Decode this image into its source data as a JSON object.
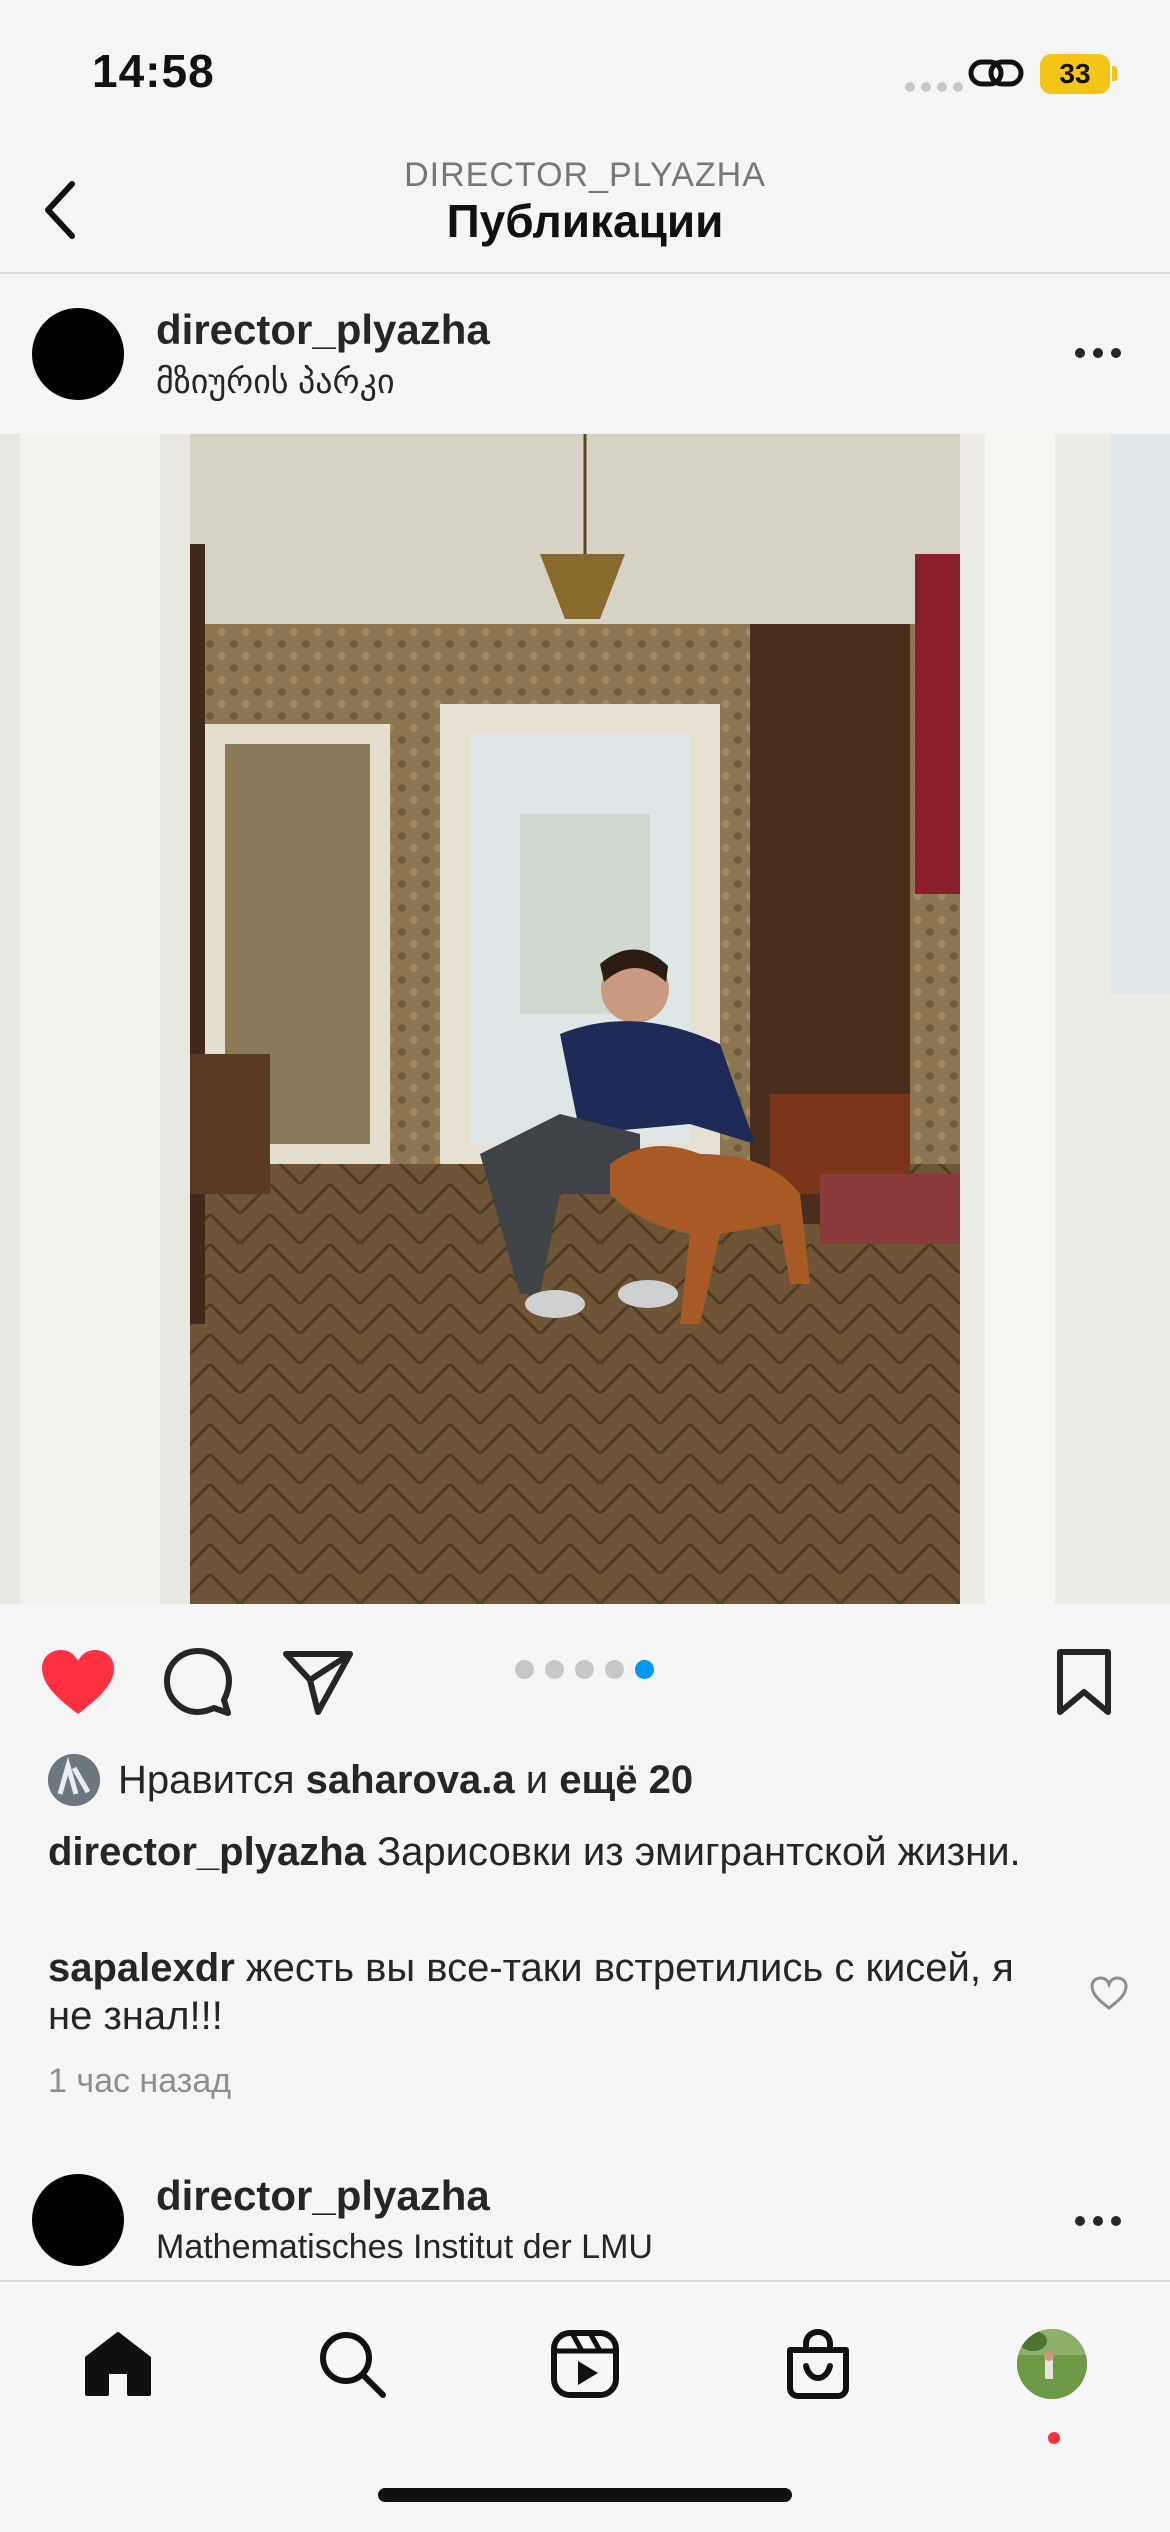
{
  "status": {
    "time": "14:58",
    "battery": "33"
  },
  "nav": {
    "subtitle": "DIRECTOR_PLYAZHA",
    "title": "Публикации"
  },
  "post": {
    "username": "director_plyazha",
    "location": "მზიურის პარკი",
    "photo_icon": "photo-room-with-man-and-dog",
    "carousel_total": 5,
    "carousel_active": 5,
    "likes_prefix": "Нравится",
    "likes_user": "saharova.a",
    "likes_and": "и",
    "likes_more": "ещё 20",
    "caption_user": "director_plyazha",
    "caption_text": "Зарисовки из эмигрантской жизни.",
    "comment_user": "sapalexdr",
    "comment_text": "жесть вы все-таки встретились с кисей, я не знал!!!",
    "time_ago": "1 час назад",
    "liked": true,
    "colors": {
      "like": "#ff3040",
      "dot_active": "#0095f6",
      "battery": "#f4c517"
    }
  },
  "next_post": {
    "username": "director_plyazha",
    "location": "Mathematisches Institut der LMU"
  },
  "tabs": [
    {
      "icon": "home-icon"
    },
    {
      "icon": "search-icon"
    },
    {
      "icon": "reels-icon"
    },
    {
      "icon": "shop-icon"
    },
    {
      "icon": "profile-avatar"
    }
  ]
}
